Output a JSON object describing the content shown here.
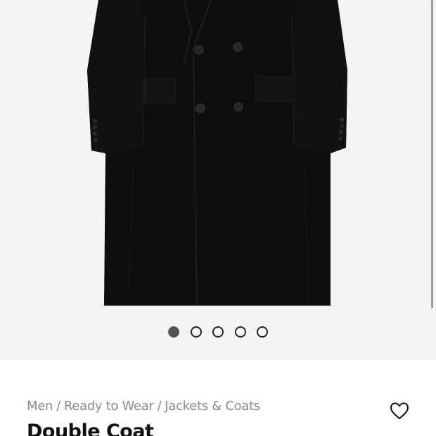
{
  "gallery": {
    "image_name": "double-coat-front-image",
    "image_count": 5,
    "active_index": 0
  },
  "breadcrumb": {
    "items": [
      "Men",
      "Ready to Wear",
      "Jackets & Coats"
    ],
    "separator": "/"
  },
  "product": {
    "title": "Double Coat"
  },
  "icons": {
    "wishlist": "heart-icon"
  },
  "colors": {
    "gallery_background": "#f4f4f4",
    "coat": "#0e0e10",
    "dot_active": "#555555",
    "breadcrumb_text": "#8a8a8a",
    "title_text": "#111111"
  }
}
